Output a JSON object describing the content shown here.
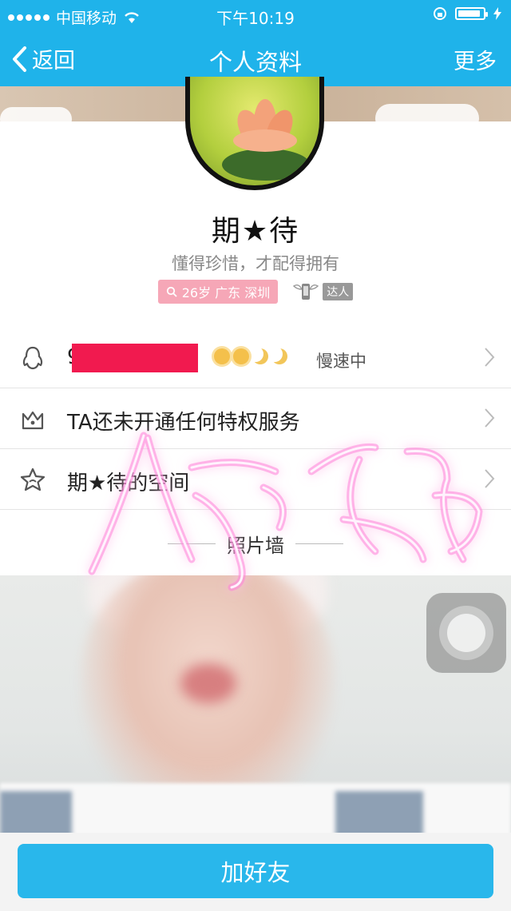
{
  "status_bar": {
    "carrier": "中国移动",
    "time": "下午10:19",
    "battery_fill": 0.9
  },
  "nav": {
    "back_label": "返回",
    "title": "个人资料",
    "more_label": "更多"
  },
  "profile": {
    "nickname": "期★待",
    "signature": "懂得珍惜，才配得拥有",
    "info_tag": "26岁 广东 深圳",
    "daren_label": "达人"
  },
  "rows": [
    {
      "icon": "penguin-icon",
      "qq_prefix": "9",
      "status": "慢速中"
    },
    {
      "icon": "crown-icon",
      "label": "TA还未开通任何特权服务"
    },
    {
      "icon": "star-icon",
      "label": "期★待的空间"
    }
  ],
  "photo_wall": {
    "title": "照片墙"
  },
  "bottom": {
    "add_friend_label": "加好友"
  },
  "colors": {
    "brand": "#1fb3ea",
    "button": "#29b7eb",
    "redaction": "#f11a4f",
    "tag_pink": "#f6a7b7"
  }
}
